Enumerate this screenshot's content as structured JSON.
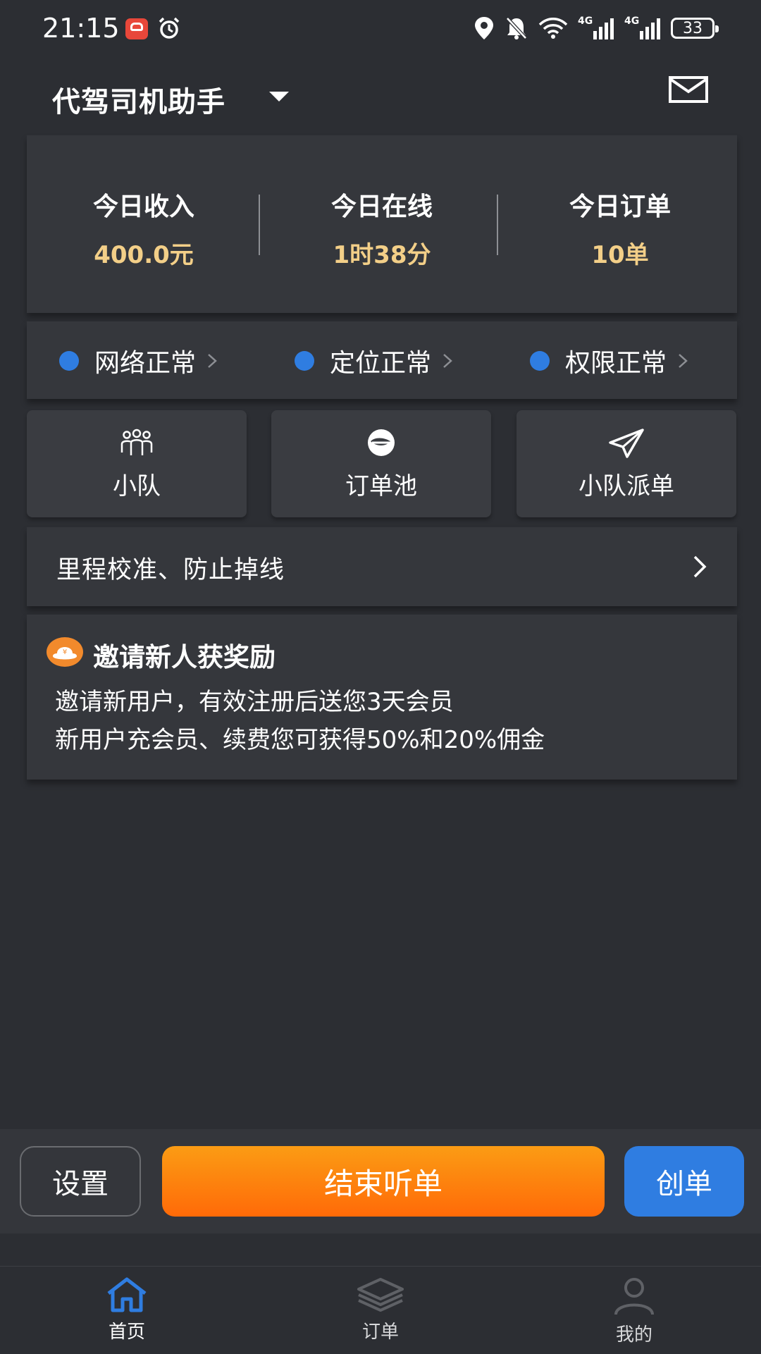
{
  "status_bar": {
    "time": "21:15",
    "network_1": "4G",
    "network_2": "4G",
    "battery": "33"
  },
  "header": {
    "title": "代驾司机助手",
    "mail_icon": "mail-icon"
  },
  "stats": [
    {
      "label": "今日收入",
      "value": "400.0元"
    },
    {
      "label": "今日在线",
      "value": "1时38分"
    },
    {
      "label": "今日订单",
      "value": "10单"
    }
  ],
  "status_checks": [
    {
      "label": "网络正常"
    },
    {
      "label": "定位正常"
    },
    {
      "label": "权限正常"
    }
  ],
  "tiles": [
    {
      "label": "小队",
      "icon": "team-icon"
    },
    {
      "label": "订单池",
      "icon": "order-pool-icon"
    },
    {
      "label": "小队派单",
      "icon": "paper-plane-icon"
    }
  ],
  "mileage": {
    "label": "里程校准、防止掉线"
  },
  "invite": {
    "title": "邀请新人获奖励",
    "line1": "邀请新用户，有效注册后送您3天会员",
    "line2": "新用户充会员、续费您可获得50%和20%佣金"
  },
  "actions": {
    "settings": "设置",
    "stop_listening": "结束听单",
    "create_order": "创单"
  },
  "tabbar": [
    {
      "label": "首页",
      "icon": "home-icon",
      "active": true
    },
    {
      "label": "订单",
      "icon": "layers-icon",
      "active": false
    },
    {
      "label": "我的",
      "icon": "user-icon",
      "active": false
    }
  ],
  "colors": {
    "background": "#2c2e33",
    "card": "#35373c",
    "accent_blue": "#2f7de1",
    "accent_orange": "#ff7a0a",
    "stat_value": "#f3cf88"
  }
}
